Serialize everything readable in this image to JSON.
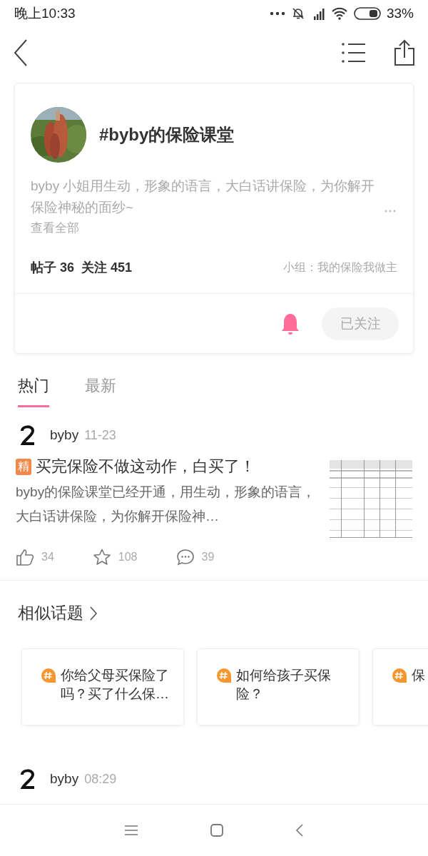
{
  "status_bar": {
    "time": "晚上10:33",
    "battery": "33%"
  },
  "topic": {
    "title": "#byby的保险课堂",
    "description": "byby 小姐用生动，形象的语言，大白话讲保险，为你解开保险神秘的面纱~",
    "see_all": "查看全部",
    "posts_label": "帖子 36",
    "follows_label": "关注 451",
    "group": "小组：我的保险我做主",
    "notify": true,
    "follow_button": {
      "label": "已关注",
      "following": true
    }
  },
  "tabs": [
    {
      "label": "热门",
      "selected": true
    },
    {
      "label": "最新",
      "selected": false
    }
  ],
  "posts": [
    {
      "author": "byby",
      "time": "11-23",
      "badge": "精",
      "title": "买完保险不做这动作，白买了！",
      "excerpt": "byby的保险课堂已经开通，用生动，形象的语言，大白话讲保险，为你解开保险神…",
      "likes": "34",
      "stars": "108",
      "comments": "39"
    },
    {
      "author": "byby",
      "time": "08:29"
    }
  ],
  "similar": {
    "title": "相似话题",
    "topics": [
      "你给父母买保险了吗？买了什么保…",
      "如何给孩子买保险？",
      "保"
    ]
  }
}
